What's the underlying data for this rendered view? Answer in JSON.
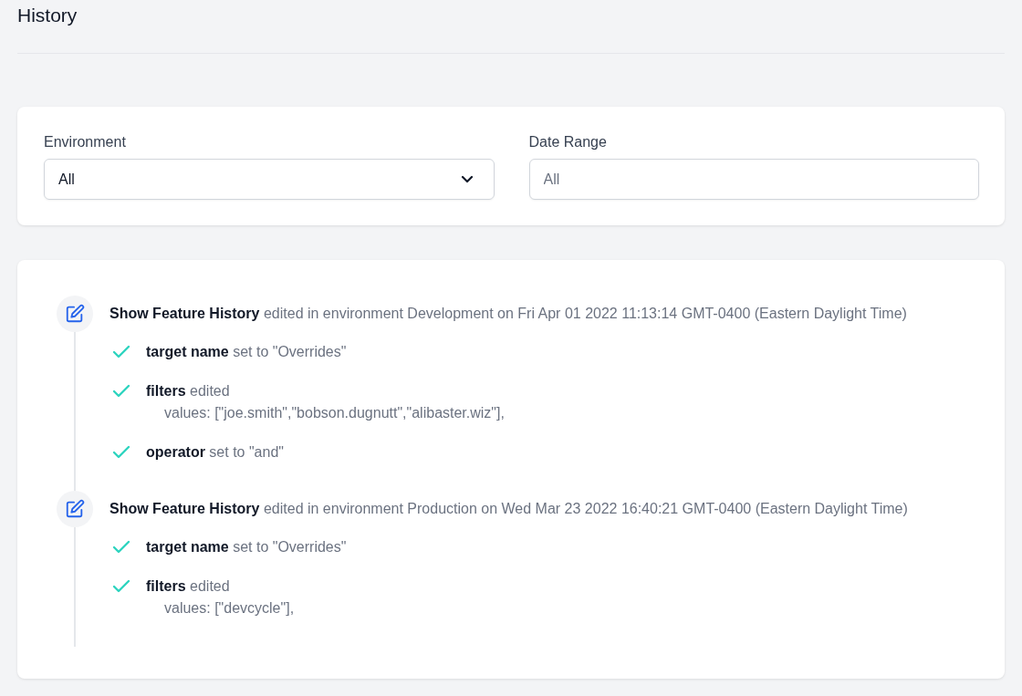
{
  "page": {
    "title": "History"
  },
  "filters": [
    {
      "label": "Environment",
      "value": "All",
      "kind": "select"
    },
    {
      "label": "Date Range",
      "placeholder": "All",
      "kind": "input"
    }
  ],
  "entries": [
    {
      "title": "Show Feature History",
      "text": "edited in environment Development on Fri Apr 01 2022 11:13:14 GMT-0400 (Eastern Daylight Time)",
      "changes": [
        {
          "field": "target name",
          "action": "set to \"Overrides\""
        },
        {
          "field": "filters",
          "action": "edited",
          "detail": "values: [\"joe.smith\",\"bobson.dugnutt\",\"alibaster.wiz\"],"
        },
        {
          "field": "operator",
          "action": "set to \"and\""
        }
      ]
    },
    {
      "title": "Show Feature History",
      "text": "edited in environment Production on Wed Mar 23 2022 16:40:21 GMT-0400 (Eastern Daylight Time)",
      "changes": [
        {
          "field": "target name",
          "action": "set to \"Overrides\""
        },
        {
          "field": "filters",
          "action": "edited",
          "detail": "values: [\"devcycle\"],"
        }
      ]
    }
  ]
}
